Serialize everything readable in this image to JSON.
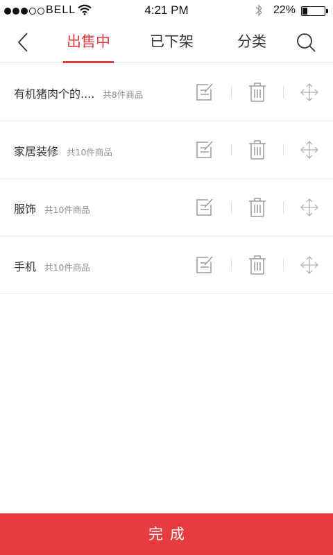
{
  "status_bar": {
    "carrier": "BELL",
    "time": "4:21 PM",
    "battery": "22%",
    "battery_level": 0.22
  },
  "nav": {
    "tabs": [
      {
        "label": "出售中",
        "active": true
      },
      {
        "label": "已下架",
        "active": false
      },
      {
        "label": "分类",
        "active": false
      }
    ],
    "accent_color": "#e23b3f"
  },
  "categories": [
    {
      "name": "有机猪肉个的....",
      "count": "共8件商品"
    },
    {
      "name": "家居装修",
      "count": "共10件商品"
    },
    {
      "name": "服饰",
      "count": "共10件商品"
    },
    {
      "name": "手机",
      "count": "共10件商品"
    }
  ],
  "icons": {
    "back": "chevron-left-icon",
    "search": "search-icon",
    "edit": "edit-icon",
    "delete": "trash-icon",
    "move": "move-icon"
  },
  "footer": {
    "done_label": "完成",
    "color": "#e63b40"
  }
}
